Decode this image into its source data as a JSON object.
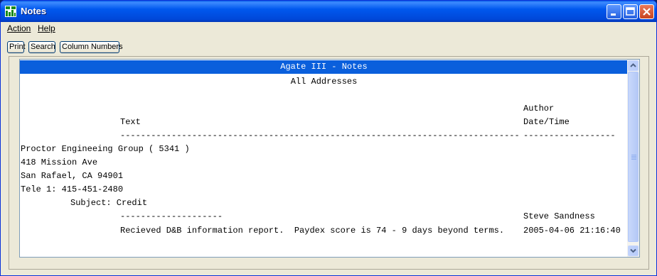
{
  "window": {
    "title": "Notes"
  },
  "menu": [
    {
      "label": "Action"
    },
    {
      "label": "Help"
    }
  ],
  "toolbar": {
    "print": "Print",
    "search": "Search",
    "columns": "Column Numbers"
  },
  "report": {
    "header": "Agate III - Notes",
    "subheader": "All Addresses",
    "col_author": "Author",
    "col_datetime": "Date/Time",
    "col_text": "Text",
    "rule_text": "----------------------------------------------------------------------------------",
    "rule_author": "------------------",
    "company_line": "Proctor Engineeing Group ( 5341 )",
    "address1": "418 Mission Ave",
    "address2": "San Rafael, CA 94901",
    "phone": "Tele 1: 415-451-2480",
    "subject": "Subject: Credit",
    "note_rule": "--------------------",
    "note_author": "Steve Sandness",
    "note_text": "Recieved D&B information report.  Paydex score is 74 - 9 days beyond terms.",
    "note_datetime": "2005-04-06 21:16:40"
  }
}
